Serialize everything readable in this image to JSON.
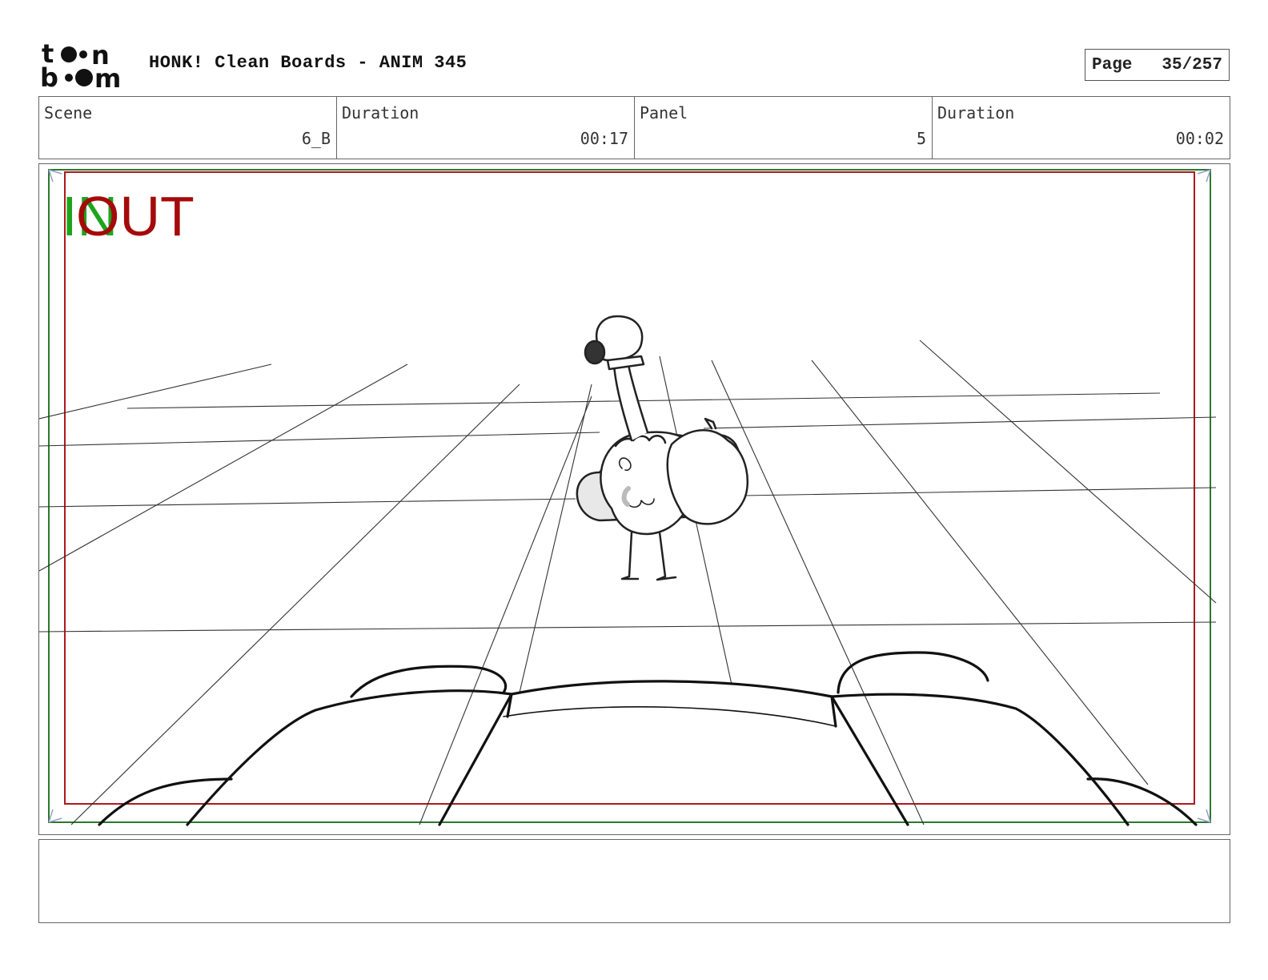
{
  "logo": {
    "text": "toon boom",
    "icon": "toon-boom-logo"
  },
  "header": {
    "title": "HONK! Clean Boards - ANIM 345"
  },
  "page": {
    "label": "Page",
    "value": "35/257"
  },
  "info": {
    "scene_label": "Scene",
    "scene_value": "6_B",
    "duration_label": "Duration",
    "duration_value": "00:17",
    "panel_label": "Panel",
    "panel_value": "5",
    "panel_duration_label": "Duration",
    "panel_duration_value": "00:02"
  },
  "frame": {
    "in_label": "IN",
    "out_label": "OUT",
    "colors": {
      "in": "#1ca51c",
      "out": "#a50a0a",
      "safe_green": "#2a7a2a",
      "safe_red": "#b01818"
    }
  },
  "notes": {
    "text": ""
  }
}
